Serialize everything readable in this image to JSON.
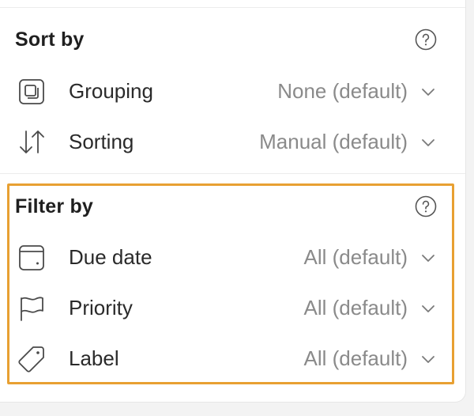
{
  "sort": {
    "title": "Sort by",
    "rows": [
      {
        "icon": "grouping-icon",
        "label": "Grouping",
        "value": "None (default)"
      },
      {
        "icon": "sort-arrows-icon",
        "label": "Sorting",
        "value": "Manual (default)"
      }
    ]
  },
  "filter": {
    "title": "Filter by",
    "rows": [
      {
        "icon": "calendar-icon",
        "label": "Due date",
        "value": "All (default)"
      },
      {
        "icon": "flag-icon",
        "label": "Priority",
        "value": "All (default)"
      },
      {
        "icon": "tag-icon",
        "label": "Label",
        "value": "All (default)"
      }
    ]
  },
  "colors": {
    "highlight": "#e8a032",
    "text": "#2a2a2a",
    "muted": "#8a8a8a"
  }
}
